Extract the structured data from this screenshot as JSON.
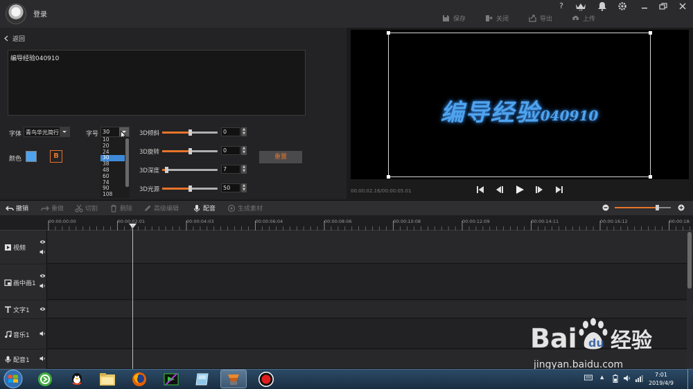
{
  "app": {
    "login_label": "登录",
    "window_controls": [
      "?",
      "VIP",
      "bell",
      "gear",
      "minimize",
      "restore",
      "close"
    ]
  },
  "header_tools": [
    {
      "label": "保存",
      "icon": "save-icon"
    },
    {
      "label": "关闭",
      "icon": "exit-icon"
    },
    {
      "label": "导出",
      "icon": "export-icon"
    },
    {
      "label": "上传",
      "icon": "upload-icon"
    }
  ],
  "editor": {
    "back_label": "返回",
    "text_value": "编导经验040910",
    "font_label": "字体",
    "font_value": "青鸟华光简行",
    "size_label": "字号",
    "size_value": "30",
    "size_options": [
      "10",
      "20",
      "24",
      "30",
      "38",
      "48",
      "60",
      "74",
      "90",
      "108"
    ],
    "size_selected_index": 3,
    "color_label": "颜色",
    "color_value": "#4fa3ee",
    "bold_label": "B",
    "reset_label": "重置",
    "sliders": [
      {
        "label": "3D倾斜",
        "value": "0",
        "level": 0.5
      },
      {
        "label": "3D旋转",
        "value": "0",
        "level": 0.5
      },
      {
        "label": "3D深度",
        "value": "7",
        "level": 0.07
      },
      {
        "label": "3D光源",
        "value": "50",
        "level": 0.5
      }
    ]
  },
  "preview": {
    "title_main": "编导经验",
    "title_num": "040910",
    "timecode": "00:00:02.16/00:00:05.01",
    "controls": [
      "skip-start-icon",
      "step-back-icon",
      "play-icon",
      "step-forward-icon",
      "skip-end-icon"
    ]
  },
  "timeline_toolbar": [
    {
      "label": "撤销",
      "icon": "undo-icon",
      "enabled": true
    },
    {
      "label": "重做",
      "icon": "redo-icon",
      "enabled": false
    },
    {
      "label": "切割",
      "icon": "scissors-icon",
      "enabled": false
    },
    {
      "label": "删除",
      "icon": "trash-icon",
      "enabled": false
    },
    {
      "label": "高级编辑",
      "icon": "pencil-icon",
      "enabled": false
    },
    {
      "label": "配音",
      "icon": "microphone-icon",
      "enabled": true
    },
    {
      "label": "生成素材",
      "icon": "material-icon",
      "enabled": false
    }
  ],
  "zoom_level": 0.75,
  "ruler_ticks": [
    "00:00:00:00",
    "00:00:02:01",
    "00:00:04:03",
    "00:00:06:04",
    "00:00:08:06",
    "00:00:10:08",
    "00:00:12:09",
    "00:00:14:11",
    "00:00:16:12",
    "00:00:18:"
  ],
  "tracks": [
    {
      "name": "视频",
      "icon": "video-icon"
    },
    {
      "name": "画中画1",
      "icon": "pip-icon"
    },
    {
      "name": "文字1",
      "icon": "text-icon"
    },
    {
      "name": "音乐1",
      "icon": "music-icon"
    },
    {
      "name": "配音1",
      "icon": "microphone-icon"
    }
  ],
  "watermark": {
    "brand_a": "Bai",
    "brand_b": "经验",
    "url": "jingyan.baidu.com"
  },
  "taskbar": {
    "time": "7:01",
    "date": "2019/4/9"
  }
}
